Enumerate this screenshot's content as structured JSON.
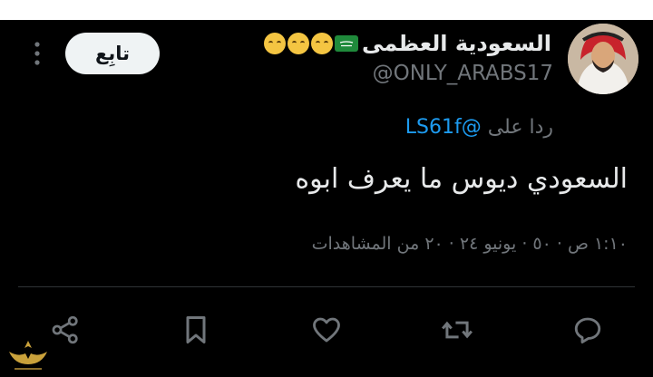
{
  "author": {
    "display_name": "السعودية العظمى",
    "handle": "@ONLY_ARABS17",
    "follow_label": "تابِع",
    "badges": [
      "saudi-flag-emoji",
      "face-emoji",
      "face-emoji",
      "face-emoji"
    ]
  },
  "reply": {
    "prefix": "ردا على",
    "mention": "@LS61f"
  },
  "tweet": {
    "text": "السعودي ديوس ما يعرف ابوه"
  },
  "meta": {
    "timestamp": "١:١٠ ص · ٥٠ · يونيو ٢٤ · ٢٠",
    "views_count": "٢٠",
    "views_label": "من المشاهدات"
  },
  "actions": [
    "share-icon",
    "bookmark-icon",
    "like-icon",
    "retweet-icon",
    "reply-icon"
  ],
  "colors": {
    "background": "#000000",
    "text": "#e7e9ea",
    "muted": "#71767b",
    "link": "#1d9bf0",
    "follow_button": "#eff3f4"
  }
}
